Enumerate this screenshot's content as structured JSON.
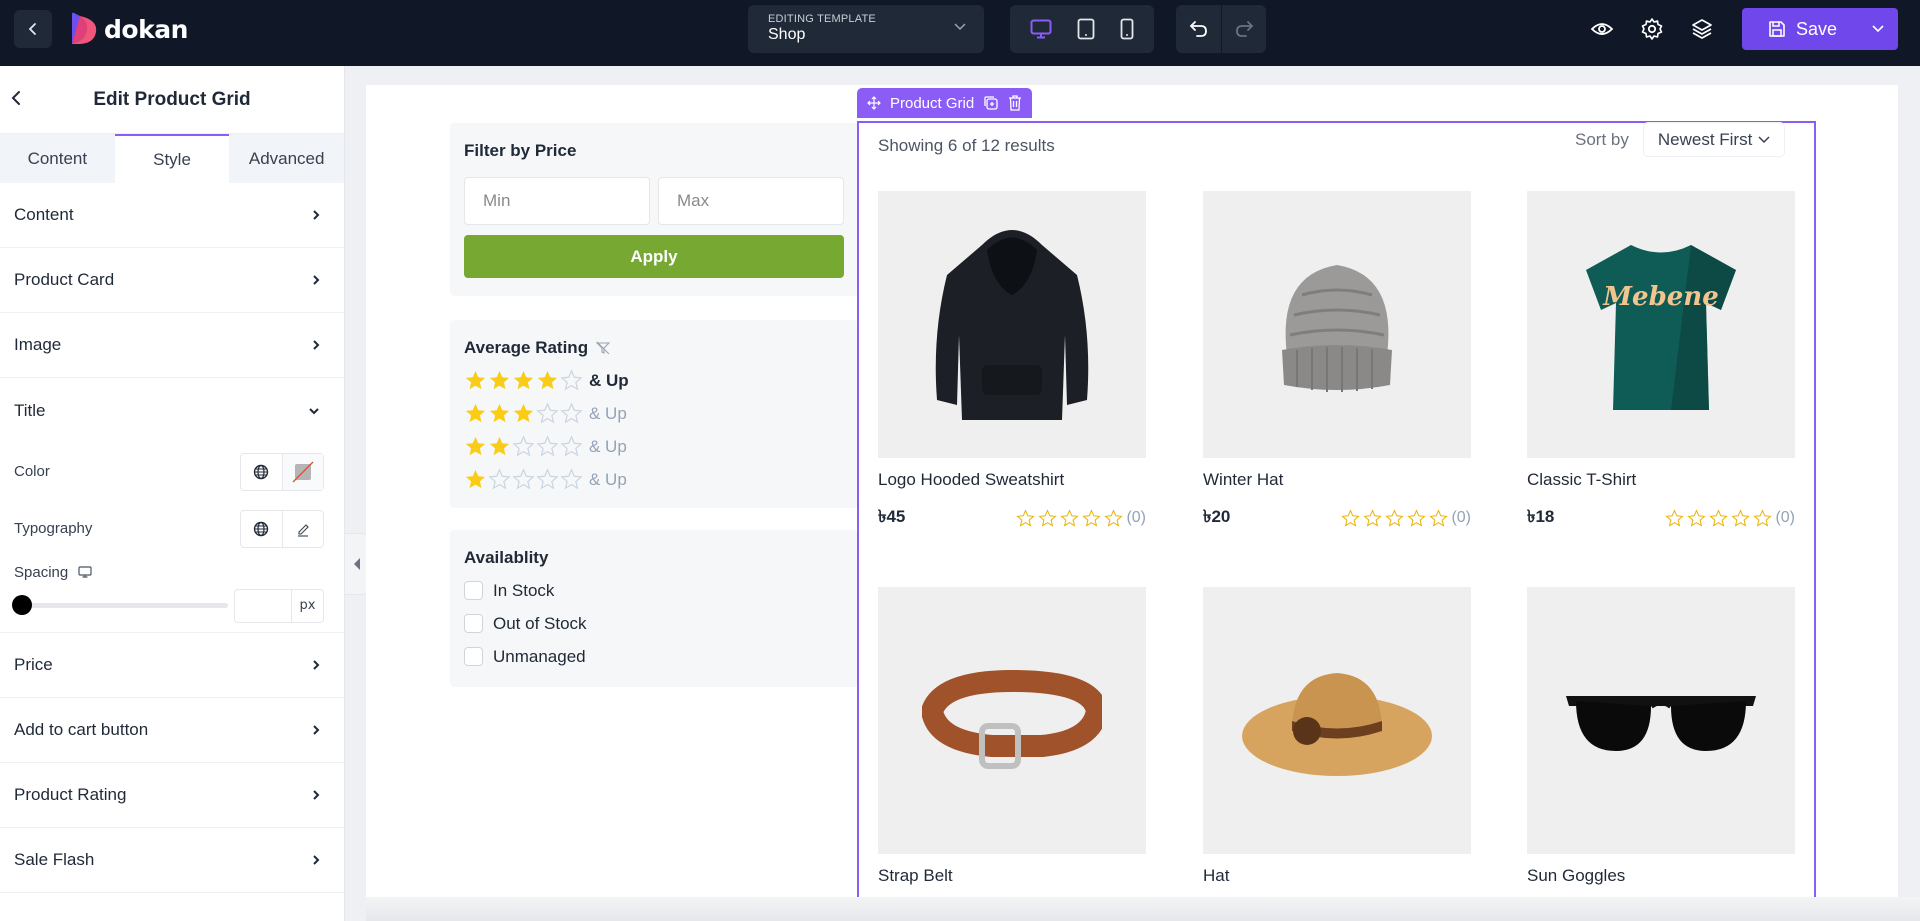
{
  "topbar": {
    "logo_text": "dokan",
    "template_label": "EDITING TEMPLATE",
    "template_value": "Shop",
    "devices": [
      "desktop",
      "tablet",
      "mobile"
    ],
    "active_device": "desktop",
    "save_label": "Save",
    "accent": "#7047eb"
  },
  "sidebar": {
    "title": "Edit Product Grid",
    "tabs": [
      {
        "label": "Content",
        "active": false
      },
      {
        "label": "Style",
        "active": true
      },
      {
        "label": "Advanced",
        "active": false
      }
    ],
    "sections_before": [
      "Content",
      "Product Card",
      "Image"
    ],
    "open_section": "Title",
    "controls": {
      "color_label": "Color",
      "typography_label": "Typography",
      "spacing_label": "Spacing",
      "spacing_value": "",
      "spacing_unit": "px",
      "spacing_slider_value": 0
    },
    "sections_after": [
      "Price",
      "Add to cart button",
      "Product Rating",
      "Sale Flash"
    ]
  },
  "filters": {
    "price": {
      "title": "Filter by Price",
      "min_placeholder": "Min",
      "max_placeholder": "Max",
      "apply_label": "Apply",
      "apply_color": "#76a832"
    },
    "rating": {
      "title": "Average Rating",
      "rows": [
        {
          "stars": 4,
          "label": "& Up",
          "active": true
        },
        {
          "stars": 3,
          "label": "& Up",
          "active": false
        },
        {
          "stars": 2,
          "label": "& Up",
          "active": false
        },
        {
          "stars": 1,
          "label": "& Up",
          "active": false
        }
      ]
    },
    "availability": {
      "title": "Availablity",
      "options": [
        {
          "label": "In Stock",
          "checked": false
        },
        {
          "label": "Out of Stock",
          "checked": false
        },
        {
          "label": "Unmanaged",
          "checked": false
        }
      ]
    }
  },
  "grid": {
    "toolbar_label": "Product Grid",
    "result_count": "Showing 6 of 12 results",
    "sort_label": "Sort by",
    "sort_value": "Newest First",
    "products": [
      {
        "title": "Logo Hooded Sweatshirt",
        "price": "৳45",
        "rating_count": "(0)",
        "image": "hoodie"
      },
      {
        "title": "Winter Hat",
        "price": "৳20",
        "rating_count": "(0)",
        "image": "beanie"
      },
      {
        "title": "Classic T-Shirt",
        "price": "৳18",
        "rating_count": "(0)",
        "image": "tshirt"
      },
      {
        "title": "Strap Belt",
        "price": "",
        "rating_count": "",
        "image": "belt"
      },
      {
        "title": "Hat",
        "price": "",
        "rating_count": "",
        "image": "sun-hat"
      },
      {
        "title": "Sun Goggles",
        "price": "",
        "rating_count": "",
        "image": "sunglasses"
      }
    ]
  }
}
